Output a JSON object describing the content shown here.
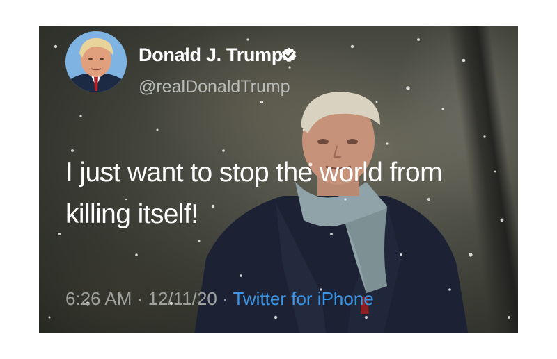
{
  "tweet": {
    "display_name": "Donald J. Trump",
    "handle": "@realDonaldTrump",
    "text_line1": "I just want to stop the world from",
    "text_line2": "killing itself!",
    "time": "6:26 AM",
    "separator": " · ",
    "date": "12/11/20",
    "source": "Twitter for iPhone"
  },
  "icons": {
    "verified": "verified-badge-icon",
    "avatar": "profile-avatar"
  },
  "colors": {
    "link_blue": "#3b95e6",
    "handle_gray": "#b9bcb9",
    "text_white": "#ffffff"
  }
}
